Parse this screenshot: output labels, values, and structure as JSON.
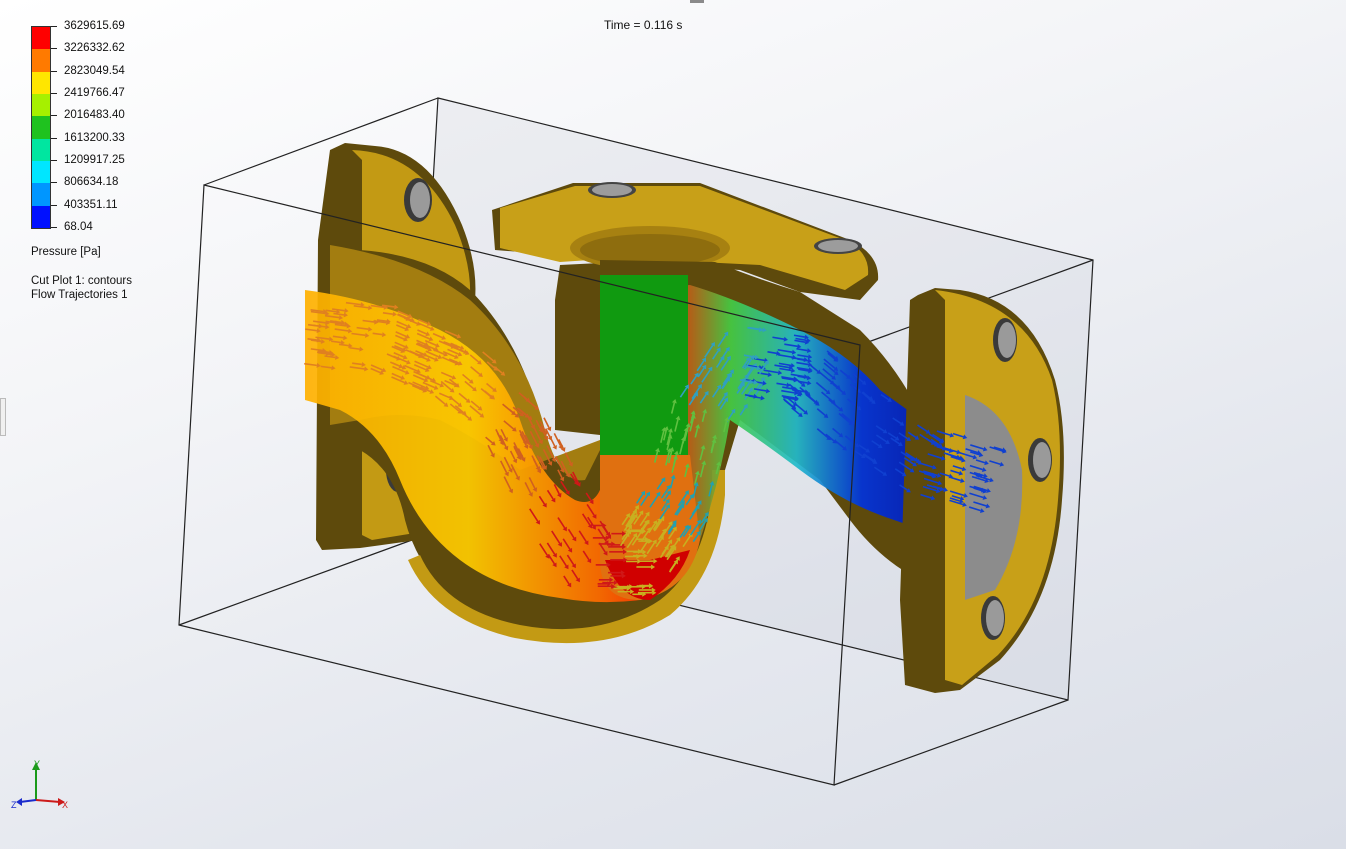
{
  "time_label": "Time = 0.116 s",
  "legend": {
    "values": [
      "3629615.69",
      "3226332.62",
      "2823049.54",
      "2419766.47",
      "2016483.40",
      "1613200.33",
      "1209917.25",
      "806634.18",
      "403351.11",
      "68.04"
    ],
    "colors": [
      "#ff0000",
      "#ff7a00",
      "#ffe600",
      "#a6f000",
      "#1fc21f",
      "#00e6a0",
      "#00e6ff",
      "#0096ff",
      "#0010ff"
    ],
    "quantity": "Pressure [Pa]",
    "plots": [
      "Cut Plot 1: contours",
      "Flow Trajectories 1"
    ]
  },
  "triad": {
    "x": "X",
    "y": "Y",
    "z": "Z"
  },
  "colors": {
    "body_dark": "#5e4a0c",
    "body_mid": "#a78111",
    "body_light": "#c9a01a",
    "wireframe": "#222222"
  }
}
